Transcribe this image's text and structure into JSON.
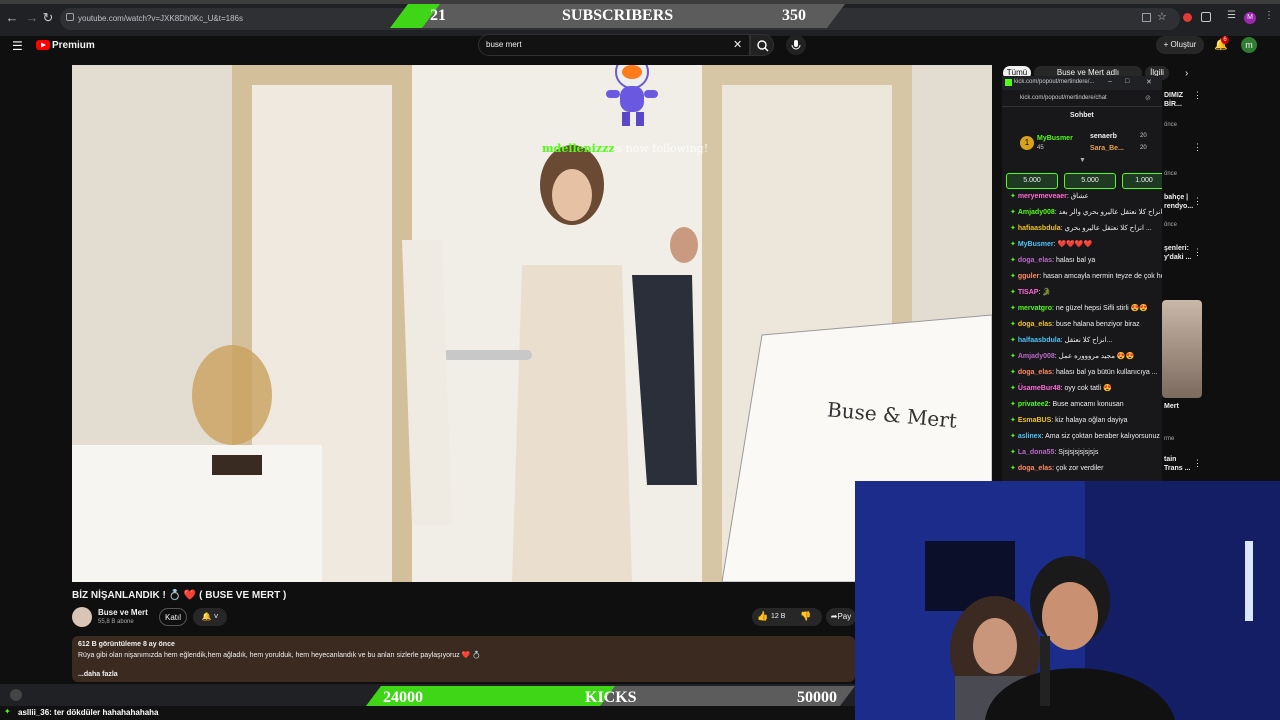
{
  "browser": {
    "url": "youtube.com/watch?v=JXK8Dh0Kc_U&t=186s"
  },
  "overlay_subscribers": {
    "left": "21",
    "label": "SUBSCRIBERS",
    "right": "350"
  },
  "youtube": {
    "logo": "Premium",
    "search_value": "buse mert",
    "create_label": "Oluştur",
    "notif_count": "6",
    "avatar_letter": "m",
    "filters": [
      "Tümü",
      "Buse ve Mert adlı yükleyiciden",
      "İlgili"
    ],
    "video_title": "BİZ NİŞANLANDIK ! 💍 ❤️ ( BUSE VE MERT )",
    "channel_name": "Buse ve Mert",
    "channel_subs": "55,8 B abone",
    "join_label": "Katıl",
    "like_count": "12 B",
    "share_label": "Pay",
    "views_line": "612 B görüntüleme  8 ay önce",
    "description": "Rüya gibi olan nişanımızda hem eğlendik,hem ağladık, hem yorulduk, hem heyecanlandık ve bu anları sizlerle paylaşıyoruz  ❤️ 💍",
    "more": "...daha fazla",
    "follow_toast_user": "mdellenizzz",
    "follow_toast_text": "is now following!",
    "sidebar_snips": [
      "DIMIZ",
      "BİR...",
      "bahçe |",
      "rendyo...",
      "şenleri:",
      "y'daki ...",
      "Mert",
      "tain",
      "Trans ..."
    ],
    "sidebar_meta": [
      "önce",
      "önce",
      "önce",
      "rme"
    ]
  },
  "kick_popout": {
    "url_title": "kick.com/popout/mertindere/...",
    "url": "kick.com/popout/mertindere/chat",
    "heading": "Sohbet",
    "leaders": [
      {
        "name": "MyBusmer",
        "amount": "45"
      },
      {
        "name": "senaerb",
        "amount": "20"
      },
      {
        "name": "Sara_Be...",
        "amount": "20"
      }
    ],
    "pins": [
      "5.000",
      "5.000",
      "1.000"
    ],
    "messages": [
      {
        "user": "meryemeveaer",
        "text": ": عشاق"
      },
      {
        "user": "Amjady008",
        "text": ": انزاح كلا نعتقل عاليرو بحري والر بعد"
      },
      {
        "user": "hafiaasbdula",
        "text": ": انزاح كلا نعتقل عاليرو بحري ..."
      },
      {
        "user": "MyBusmer",
        "text": ": ❤️❤️❤️❤️"
      },
      {
        "user": "doga_elas",
        "text": ": halası bal ya"
      },
      {
        "user": "gguler",
        "text": ": hasan amcayla nermin teyze de çok heyecanlı 😍"
      },
      {
        "user": "TISAP",
        "text": ": 🐊"
      },
      {
        "user": "mervatgro",
        "text": ": ne güzel hepsi Sifli stirli 😍😍"
      },
      {
        "user": "doga_elas",
        "text": ": buse halana benziyor biraz"
      },
      {
        "user": "halfaasbdula",
        "text": ": انزاح كلا نعتقل..."
      },
      {
        "user": "Amjady008",
        "text": ": مجيد مروووره عمل 😍😍"
      },
      {
        "user": "doga_elas",
        "text": ": halası bal ya bütün kullanıcıya ..."
      },
      {
        "user": "ÜsameBur48",
        "text": ": oyy cok tatli 😍"
      },
      {
        "user": "privatee2",
        "text": ": Buse amcamı konusan"
      },
      {
        "user": "EsmaBUS",
        "text": ": kiz halaya oğlan dayiya"
      },
      {
        "user": "aslinex",
        "text": ": Ama siz çoktan beraber kalıyorsunuz 😁"
      },
      {
        "user": "La_dona55",
        "text": ": Sjsjsjsjsjsjsjs"
      },
      {
        "user": "doga_elas",
        "text": ": çok zor verdiler"
      }
    ]
  },
  "overlay_kicks": {
    "left": "24000",
    "label": "KICKS",
    "right": "50000"
  },
  "bottom_chat": {
    "user": "asllii_36",
    "text": ": ter dökdüler hahahahahaha"
  },
  "colors": {
    "green": "#53fc18",
    "youtube_red": "#ff0000",
    "kick_bg": "#18181b"
  }
}
